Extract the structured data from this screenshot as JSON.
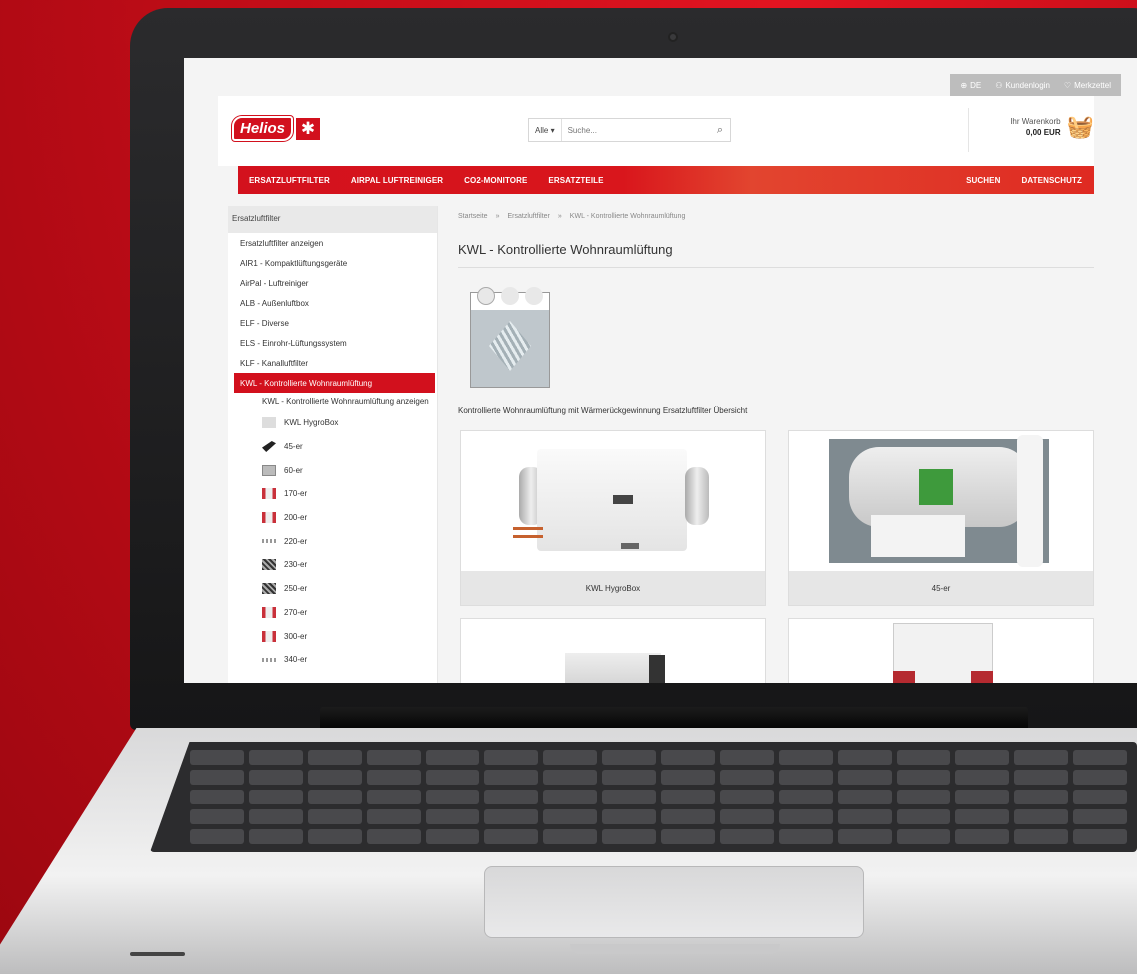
{
  "utility": {
    "language": "DE",
    "login": "Kundenlogin",
    "wishlist": "Merkzettel"
  },
  "header": {
    "logo_text": "Helios",
    "search_category": "Alle",
    "search_placeholder": "Suche...",
    "cart_label": "Ihr Warenkorb",
    "cart_total": "0,00 EUR"
  },
  "nav": {
    "left": [
      "ERSATZLUFTFILTER",
      "AIRPAL LUFTREINIGER",
      "CO2-MONITORE",
      "ERSATZTEILE"
    ],
    "right": [
      "SUCHEN",
      "DATENSCHUTZ"
    ]
  },
  "sidebar": {
    "heading": "Ersatzluftfilter",
    "items": [
      "Ersatzluftfilter anzeigen",
      "AIR1 - Kompaktlüftungsgeräte",
      "AirPal - Luftreiniger",
      "ALB - Außenluftbox",
      "ELF - Diverse",
      "ELS - Einrohr-Lüftungssystem",
      "KLF - Kanalluftfilter"
    ],
    "active_item": "KWL - Kontrollierte Wohnraumlüftung",
    "sub_show": "KWL - Kontrollierte Wohnraumlüftung anzeigen",
    "products": [
      "KWL HygroBox",
      "45-er",
      "60-er",
      "170-er",
      "200-er",
      "220-er",
      "230-er",
      "250-er",
      "270-er",
      "300-er",
      "340-er"
    ]
  },
  "main": {
    "breadcrumb": [
      "Startseite",
      "»",
      "Ersatzluftfilter",
      "»",
      "KWL - Kontrollierte Wohnraumlüftung"
    ],
    "title": "KWL - Kontrollierte Wohnraumlüftung",
    "description": "Kontrollierte Wohnraumlüftung mit Wärmerückgewinnung Ersatzluftfilter Übersicht",
    "cards": [
      "KWL HygroBox",
      "45-er"
    ]
  },
  "colors": {
    "brand_red": "#d2101d",
    "background_red": "#c40d18"
  }
}
